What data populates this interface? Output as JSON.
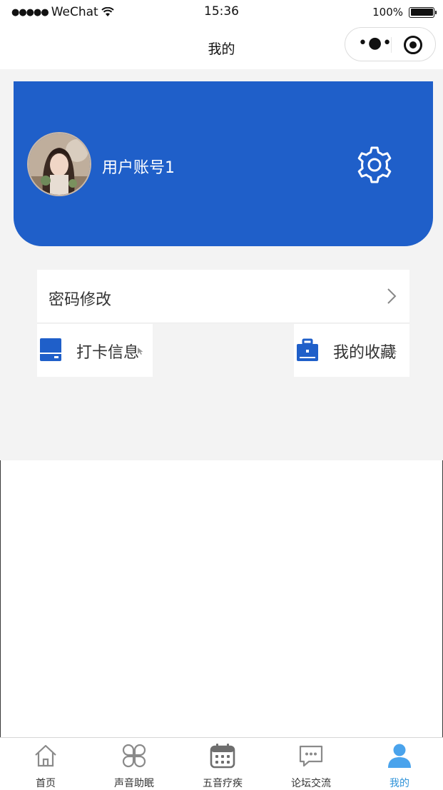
{
  "status_bar": {
    "signal": "●●●●●",
    "carrier": "WeChat",
    "time": "15:36",
    "battery": "100%"
  },
  "nav": {
    "title": "我的",
    "menu_icon": "more-dots-icon",
    "close_icon": "target-close-icon"
  },
  "profile": {
    "username": "用户账号1",
    "avatar_icon": "user-avatar-photo",
    "settings_icon": "gear-icon",
    "background_color": "#1f5fc9"
  },
  "menu": {
    "password": "密码修改",
    "checkin": "打卡信息",
    "favorites": "我的收藏"
  },
  "tabbar": {
    "active_color": "#2f93d9",
    "items": [
      {
        "label": "首页",
        "icon": "home-icon"
      },
      {
        "label": "声音助眠",
        "icon": "clover-icon"
      },
      {
        "label": "五音疗疾",
        "icon": "calendar-icon"
      },
      {
        "label": "论坛交流",
        "icon": "chat-icon"
      },
      {
        "label": "我的",
        "icon": "person-icon"
      }
    ]
  }
}
